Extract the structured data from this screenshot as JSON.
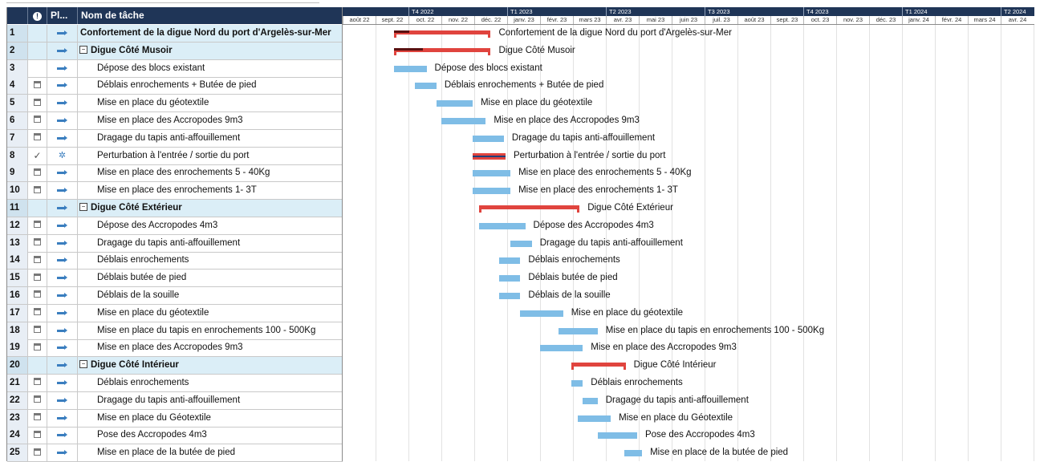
{
  "header": {
    "id": "",
    "indicators": "",
    "mode": "Pl...",
    "name": "Nom de tâche"
  },
  "quarters": [
    {
      "label": "T4 2022",
      "month_index": 2
    },
    {
      "label": "T1 2023",
      "month_index": 5
    },
    {
      "label": "T2 2023",
      "month_index": 8
    },
    {
      "label": "T3 2023",
      "month_index": 11
    },
    {
      "label": "T4 2023",
      "month_index": 14
    },
    {
      "label": "T1 2024",
      "month_index": 17
    },
    {
      "label": "T2 2024",
      "month_index": 20
    }
  ],
  "months": [
    "août 22",
    "sept. 22",
    "oct. 22",
    "nov. 22",
    "déc. 22",
    "janv. 23",
    "févr. 23",
    "mars 23",
    "avr. 23",
    "mai 23",
    "juin 23",
    "juil. 23",
    "août 23",
    "sept. 23",
    "oct. 23",
    "nov. 23",
    "déc. 23",
    "janv. 24",
    "févr. 24",
    "mars 24",
    "avr. 24"
  ],
  "tasks": [
    {
      "id": "1",
      "level": "top",
      "indicator": "",
      "mode": "auto",
      "name": "Confortement de la digue Nord du port d'Argelès-sur-Mer",
      "type": "summary",
      "start": 1.55,
      "end": 4.5,
      "progress": 0.16
    },
    {
      "id": "2",
      "level": "summary",
      "indicator": "",
      "mode": "auto",
      "name": "Digue Côté Musoir",
      "type": "summary",
      "start": 1.55,
      "end": 4.5,
      "progress": 0.3
    },
    {
      "id": "3",
      "level": "task",
      "indicator": "",
      "mode": "auto",
      "name": "Dépose des blocs existant",
      "type": "task",
      "start": 1.55,
      "end": 2.55
    },
    {
      "id": "4",
      "level": "task",
      "indicator": "calendar",
      "mode": "auto",
      "name": "Déblais enrochements + Butée de pied",
      "type": "task",
      "start": 2.2,
      "end": 2.85
    },
    {
      "id": "5",
      "level": "task",
      "indicator": "calendar",
      "mode": "auto",
      "name": "Mise en place du géotextile",
      "type": "task",
      "start": 2.85,
      "end": 3.95
    },
    {
      "id": "6",
      "level": "task",
      "indicator": "calendar",
      "mode": "auto",
      "name": "Mise en place des Accropodes 9m3",
      "type": "task",
      "start": 3.0,
      "end": 4.35
    },
    {
      "id": "7",
      "level": "task",
      "indicator": "calendar",
      "mode": "auto",
      "name": "Dragage du tapis anti-affouillement",
      "type": "task",
      "start": 3.95,
      "end": 4.9
    },
    {
      "id": "8",
      "level": "task",
      "indicator": "check",
      "mode": "pin",
      "name": "Perturbation à l'entrée / sortie du port",
      "type": "perturbation",
      "start": 3.95,
      "end": 4.95
    },
    {
      "id": "9",
      "level": "task",
      "indicator": "calendar",
      "mode": "auto",
      "name": "Mise en place des enrochements 5 - 40Kg",
      "type": "task",
      "start": 3.95,
      "end": 5.1
    },
    {
      "id": "10",
      "level": "task",
      "indicator": "calendar",
      "mode": "auto",
      "name": "Mise en place des enrochements 1- 3T",
      "type": "task",
      "start": 3.95,
      "end": 5.1
    },
    {
      "id": "11",
      "level": "summary",
      "indicator": "",
      "mode": "auto",
      "name": "Digue Côté Extérieur",
      "type": "summary",
      "start": 4.15,
      "end": 7.2,
      "progress": 0
    },
    {
      "id": "12",
      "level": "task",
      "indicator": "calendar",
      "mode": "auto",
      "name": "Dépose des Accropodes 4m3",
      "type": "task",
      "start": 4.15,
      "end": 5.55
    },
    {
      "id": "13",
      "level": "task",
      "indicator": "calendar",
      "mode": "auto",
      "name": "Dragage du tapis anti-affouillement",
      "type": "task",
      "start": 5.1,
      "end": 5.75
    },
    {
      "id": "14",
      "level": "task",
      "indicator": "calendar",
      "mode": "auto",
      "name": "Déblais enrochements",
      "type": "task",
      "start": 4.75,
      "end": 5.4
    },
    {
      "id": "15",
      "level": "task",
      "indicator": "calendar",
      "mode": "auto",
      "name": "Déblais butée de pied",
      "type": "task",
      "start": 4.75,
      "end": 5.4
    },
    {
      "id": "16",
      "level": "task",
      "indicator": "calendar",
      "mode": "auto",
      "name": "Déblais de la souille",
      "type": "task",
      "start": 4.75,
      "end": 5.4
    },
    {
      "id": "17",
      "level": "task",
      "indicator": "calendar",
      "mode": "auto",
      "name": "Mise en place du géotextile",
      "type": "task",
      "start": 5.4,
      "end": 6.7
    },
    {
      "id": "18",
      "level": "task",
      "indicator": "calendar",
      "mode": "auto",
      "name": "Mise en place du tapis en enrochements 100 - 500Kg",
      "type": "task",
      "start": 6.55,
      "end": 7.75
    },
    {
      "id": "19",
      "level": "task",
      "indicator": "calendar",
      "mode": "auto",
      "name": "Mise en place des Accropodes 9m3",
      "type": "task",
      "start": 6.0,
      "end": 7.3
    },
    {
      "id": "20",
      "level": "summary",
      "indicator": "",
      "mode": "auto",
      "name": "Digue Côté Intérieur",
      "type": "summary",
      "start": 6.95,
      "end": 8.6,
      "progress": 0
    },
    {
      "id": "21",
      "level": "task",
      "indicator": "calendar",
      "mode": "auto",
      "name": "Déblais enrochements",
      "type": "task",
      "start": 6.95,
      "end": 7.3
    },
    {
      "id": "22",
      "level": "task",
      "indicator": "calendar",
      "mode": "auto",
      "name": "Dragage du tapis anti-affouillement",
      "type": "task",
      "start": 7.3,
      "end": 7.75
    },
    {
      "id": "23",
      "level": "task",
      "indicator": "calendar",
      "mode": "auto",
      "name": "Mise en place du Géotextile",
      "type": "task",
      "start": 7.15,
      "end": 8.15
    },
    {
      "id": "24",
      "level": "task",
      "indicator": "calendar",
      "mode": "auto",
      "name": "Pose des Accropodes 4m3",
      "type": "task",
      "start": 7.75,
      "end": 8.95
    },
    {
      "id": "25",
      "level": "task",
      "indicator": "calendar",
      "mode": "auto",
      "name": "Mise en place de la butée de pied",
      "type": "task",
      "start": 8.55,
      "end": 9.1
    }
  ],
  "colors": {
    "header_bg": "#1f3557",
    "summary_row_bg": "#dbeef7",
    "task_bar": "#7fbde6",
    "summary_bar": "#e0443e",
    "summary_progress": "#5a1010",
    "perturbation_line": "#1f3f7a"
  }
}
